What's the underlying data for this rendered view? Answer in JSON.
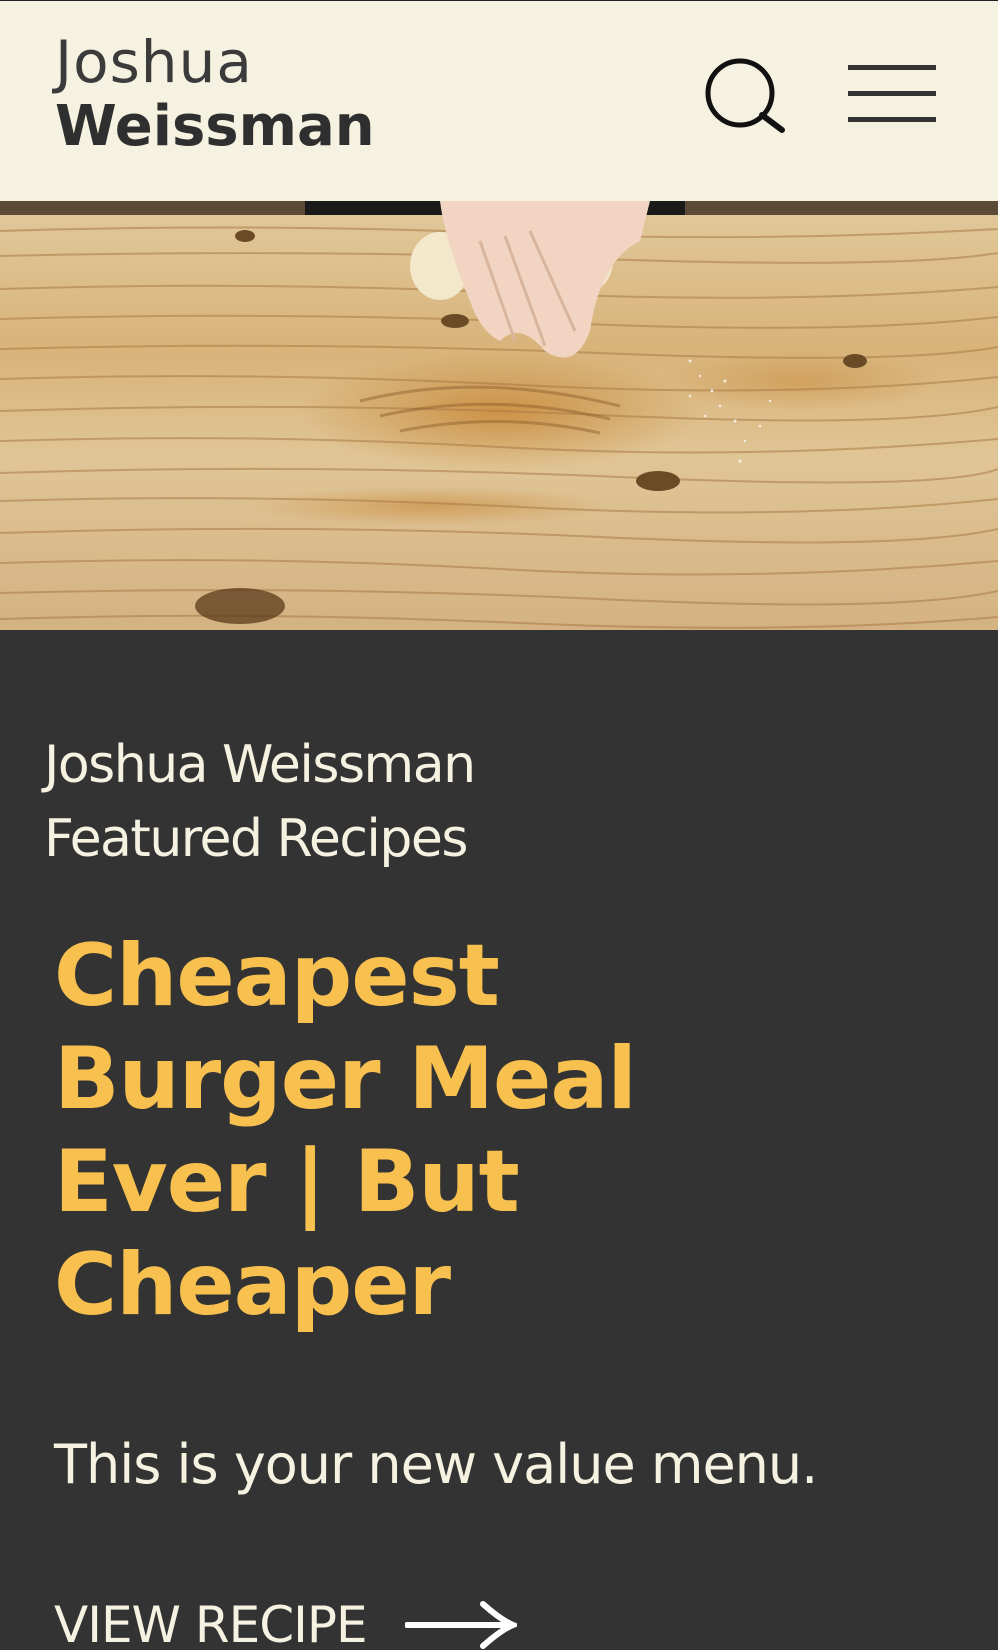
{
  "header": {
    "logo_first": "Joshua",
    "logo_last": "Weissman",
    "search_icon": "search-icon",
    "menu_icon": "hamburger-menu-icon"
  },
  "hero": {
    "image": "hands rolling dough on wooden table"
  },
  "featured": {
    "section_title_line1": "Joshua Weissman",
    "section_title_line2": "Featured Recipes",
    "recipe_title_line1": "Cheapest",
    "recipe_title_line2": "Burger Meal",
    "recipe_title_line3": "Ever | But",
    "recipe_title_line4": "Cheaper",
    "description": "This is your new value menu.",
    "cta_label": "VIEW RECIPE",
    "cta_icon": "arrow-right-icon"
  },
  "colors": {
    "header_bg": "#f5f2e1",
    "content_bg": "#333333",
    "accent": "#f7c04f",
    "text_light": "#f5f2e1"
  }
}
